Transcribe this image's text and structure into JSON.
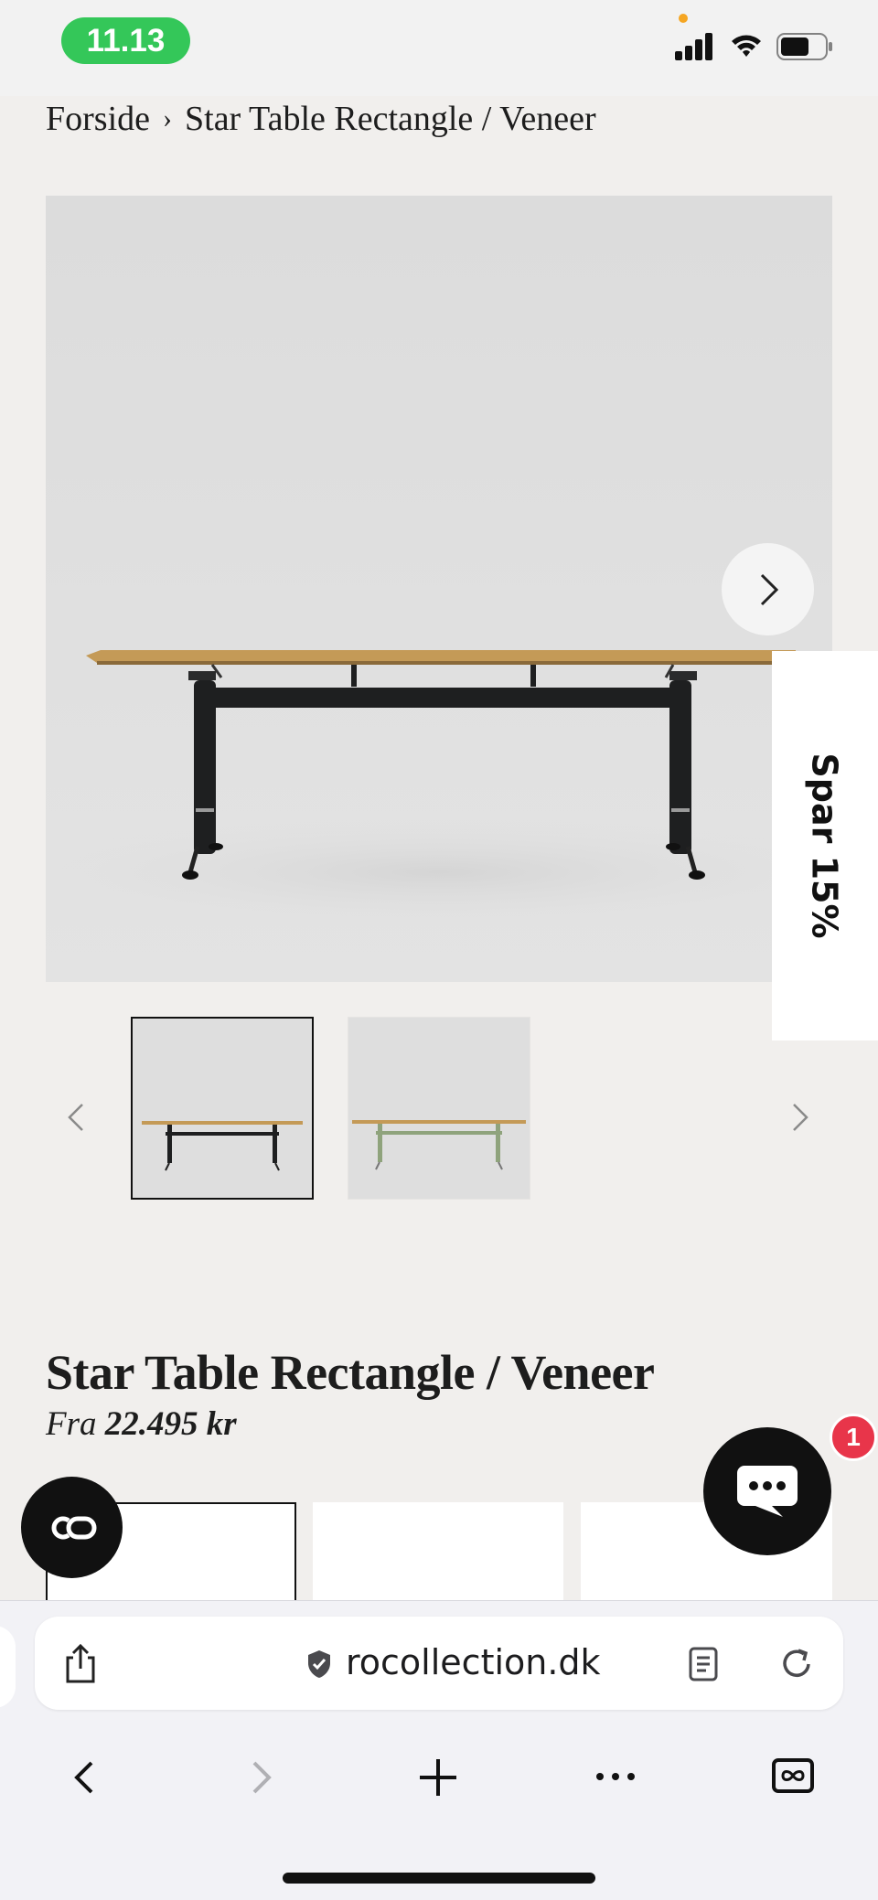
{
  "status_bar": {
    "time": "11.13"
  },
  "breadcrumb": {
    "home": "Forside",
    "separator": "›",
    "current": "Star Table Rectangle / Veneer"
  },
  "gallery": {
    "promo_label": "Spar 15%",
    "thumbnail_count": 2,
    "selected_thumbnail": 1
  },
  "product": {
    "title": "Star Table Rectangle / Veneer",
    "price_prefix": "Fra",
    "price_value": "22.495 kr"
  },
  "chat": {
    "badge_count": "1"
  },
  "browser": {
    "url": "rocollection.dk"
  },
  "colors": {
    "background": "#f1efed",
    "status_pill": "#34c759",
    "badge": "#e8354a",
    "table_top": "#c49a57",
    "frame_dark": "#1e1f20",
    "frame_green": "#8fa37c"
  }
}
